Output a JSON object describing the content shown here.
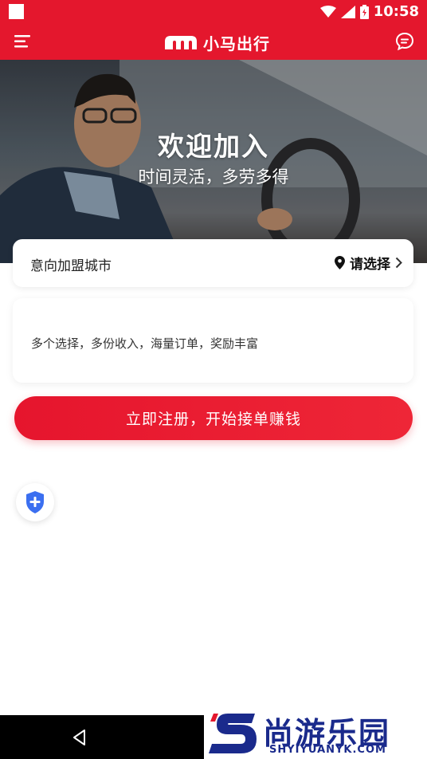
{
  "status_bar": {
    "time": "10:58"
  },
  "header": {
    "brand": "小马出行"
  },
  "hero": {
    "title": "欢迎加入",
    "subtitle": "时间灵活，多劳多得"
  },
  "city": {
    "label": "意向加盟城市",
    "select": "请选择"
  },
  "info": {
    "text": "多个选择，多份收入，海量订单，奖励丰富"
  },
  "register": {
    "label": "立即注册，开始接单赚钱"
  },
  "watermark": {
    "brand": "尚游乐园",
    "url": "SHYIYUANYK.COM"
  },
  "colors": {
    "accent": "#e4172d",
    "shield": "#3b6ff0"
  }
}
